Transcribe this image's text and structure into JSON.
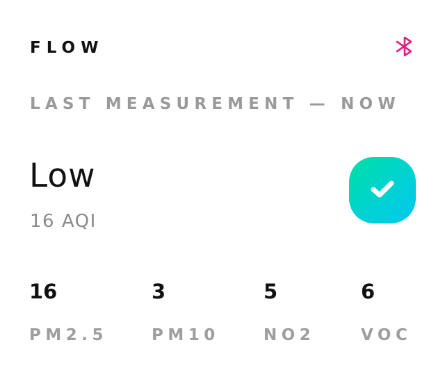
{
  "header": {
    "app_title": "FLOW",
    "bluetooth_icon": "bluetooth-icon",
    "bluetooth_color": "#e0217e"
  },
  "status": {
    "last_measurement": "LAST MEASUREMENT — NOW",
    "level": "Low",
    "aqi": "16 AQI",
    "badge_icon": "checkmark-icon",
    "badge_colors": [
      "#00dfa4",
      "#00c8ee"
    ]
  },
  "pollutants": [
    {
      "value": "16",
      "label": "PM2.5"
    },
    {
      "value": "3",
      "label": "PM10"
    },
    {
      "value": "5",
      "label": "NO2"
    },
    {
      "value": "6",
      "label": "VOC"
    }
  ]
}
